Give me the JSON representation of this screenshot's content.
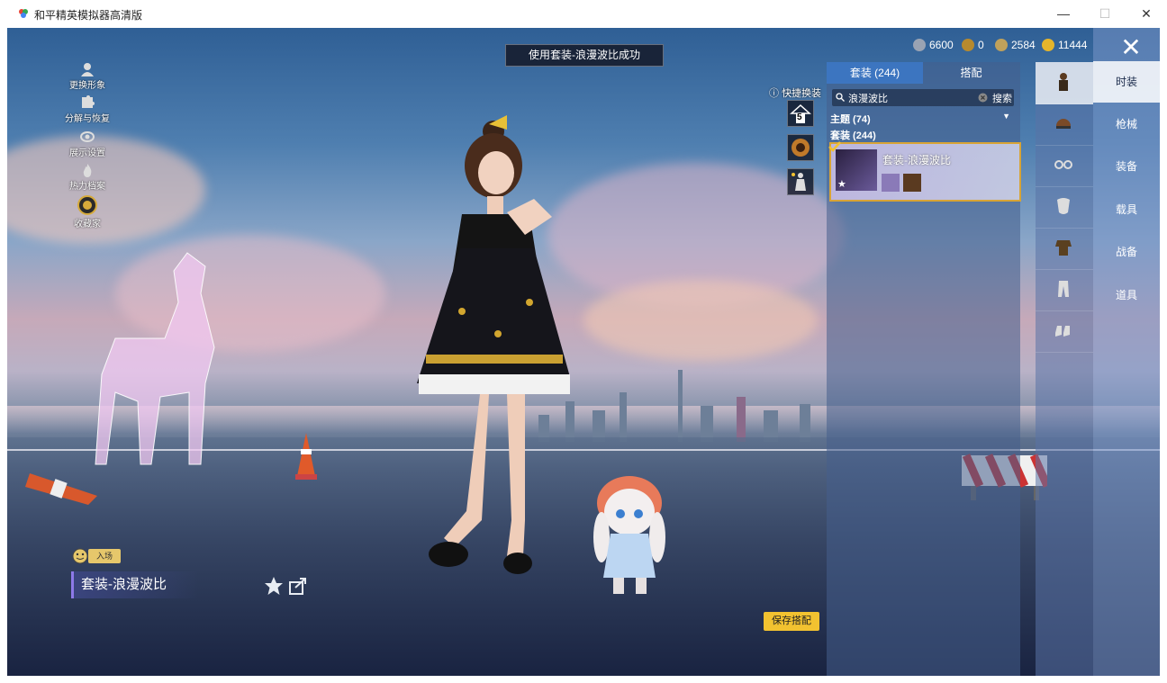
{
  "window": {
    "title": "和平精英模拟器高清版",
    "min": "—",
    "max": "☐",
    "close": "✕"
  },
  "toast": "使用套装-浪漫波比成功",
  "currencies": [
    {
      "value": "6600",
      "color": "#9aa3b3"
    },
    {
      "value": "0",
      "color": "#b78a2e"
    },
    {
      "value": "2584",
      "color": "#c0a15b"
    },
    {
      "value": "11444",
      "color": "#e5b52b"
    }
  ],
  "left_menu": [
    {
      "label": "更换形象",
      "icon": "person-icon"
    },
    {
      "label": "分解与恢复",
      "icon": "puzzle-icon"
    },
    {
      "label": "展示设置",
      "icon": "eye-icon"
    },
    {
      "label": "热力档案",
      "icon": "fire-icon"
    },
    {
      "label": "收藏家",
      "icon": "collector-badge-icon"
    }
  ],
  "quick_change": {
    "label": "快捷换装",
    "slot1_number": "5"
  },
  "panel": {
    "tab_outfits": "套装 (244)",
    "tab_match": "搭配",
    "search_value": "浪漫波比",
    "search_button": "搜索",
    "theme_label": "主题 (74)",
    "outfits_label": "套装 (244)",
    "item_name": "套装-浪漫波比"
  },
  "right_tabs": [
    "时装",
    "枪械",
    "装备",
    "载具",
    "战备",
    "道具"
  ],
  "categories": [
    "outfit-icon",
    "helmet-icon",
    "glasses-icon",
    "mask-icon",
    "top-icon",
    "pants-icon",
    "shoes-icon"
  ],
  "bottom": {
    "entry_badge": "入场",
    "outfit_name": "套装-浪漫波比",
    "save_button": "保存搭配"
  },
  "colors": {
    "accent_gold": "#f2c230",
    "tab_blue": "#3c78c8",
    "selected_border": "#d8a435"
  }
}
